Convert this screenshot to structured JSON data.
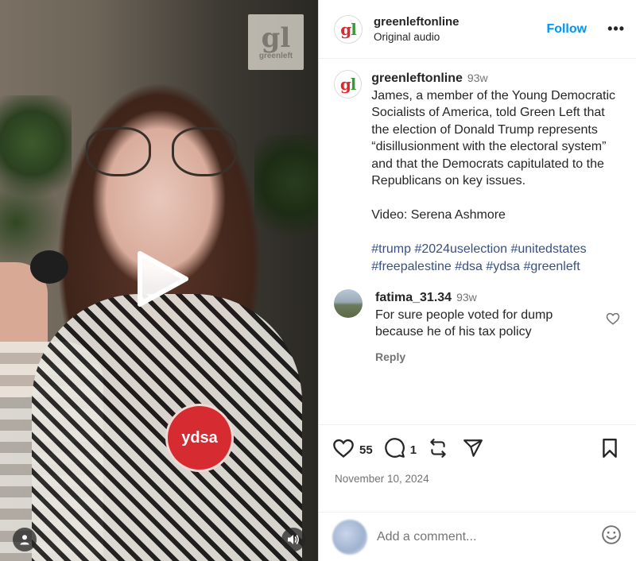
{
  "media": {
    "watermark_logo": "gl",
    "watermark_text": "greenleft",
    "badge_text": "ydsa",
    "play_icon": "play-icon",
    "user_icon": "user-icon",
    "audio_icon": "speaker-icon"
  },
  "header": {
    "avatar_g": "g",
    "avatar_l": "l",
    "username": "greenleftonline",
    "subtitle": "Original audio",
    "follow_label": "Follow",
    "more_label": "•••"
  },
  "caption": {
    "username": "greenleftonline",
    "time": "93w",
    "text": "James, a member of the Young Democratic Socialists of America, told Green Left that the election of Donald Trump represents “disillusionment with the electoral system” and that the Democrats capitulated to the Republicans on key issues.",
    "credit": "Video: Serena Ashmore",
    "hashtags": "#trump #2024uselection #unitedstates #freepalestine #dsa #ydsa #greenleft"
  },
  "comments": [
    {
      "username": "fatima_31.34",
      "time": "93w",
      "text": "For sure people voted for dump because he of his tax policy",
      "reply_label": "Reply"
    }
  ],
  "actions": {
    "likes": "55",
    "comments_count": "1",
    "date": "November 10, 2024"
  },
  "add_comment": {
    "placeholder": "Add a comment..."
  },
  "colors": {
    "accent": "#0095f6",
    "hashtag": "#385185",
    "muted": "#737373",
    "logo_red": "#d62b31",
    "logo_green": "#3a9a3a"
  }
}
